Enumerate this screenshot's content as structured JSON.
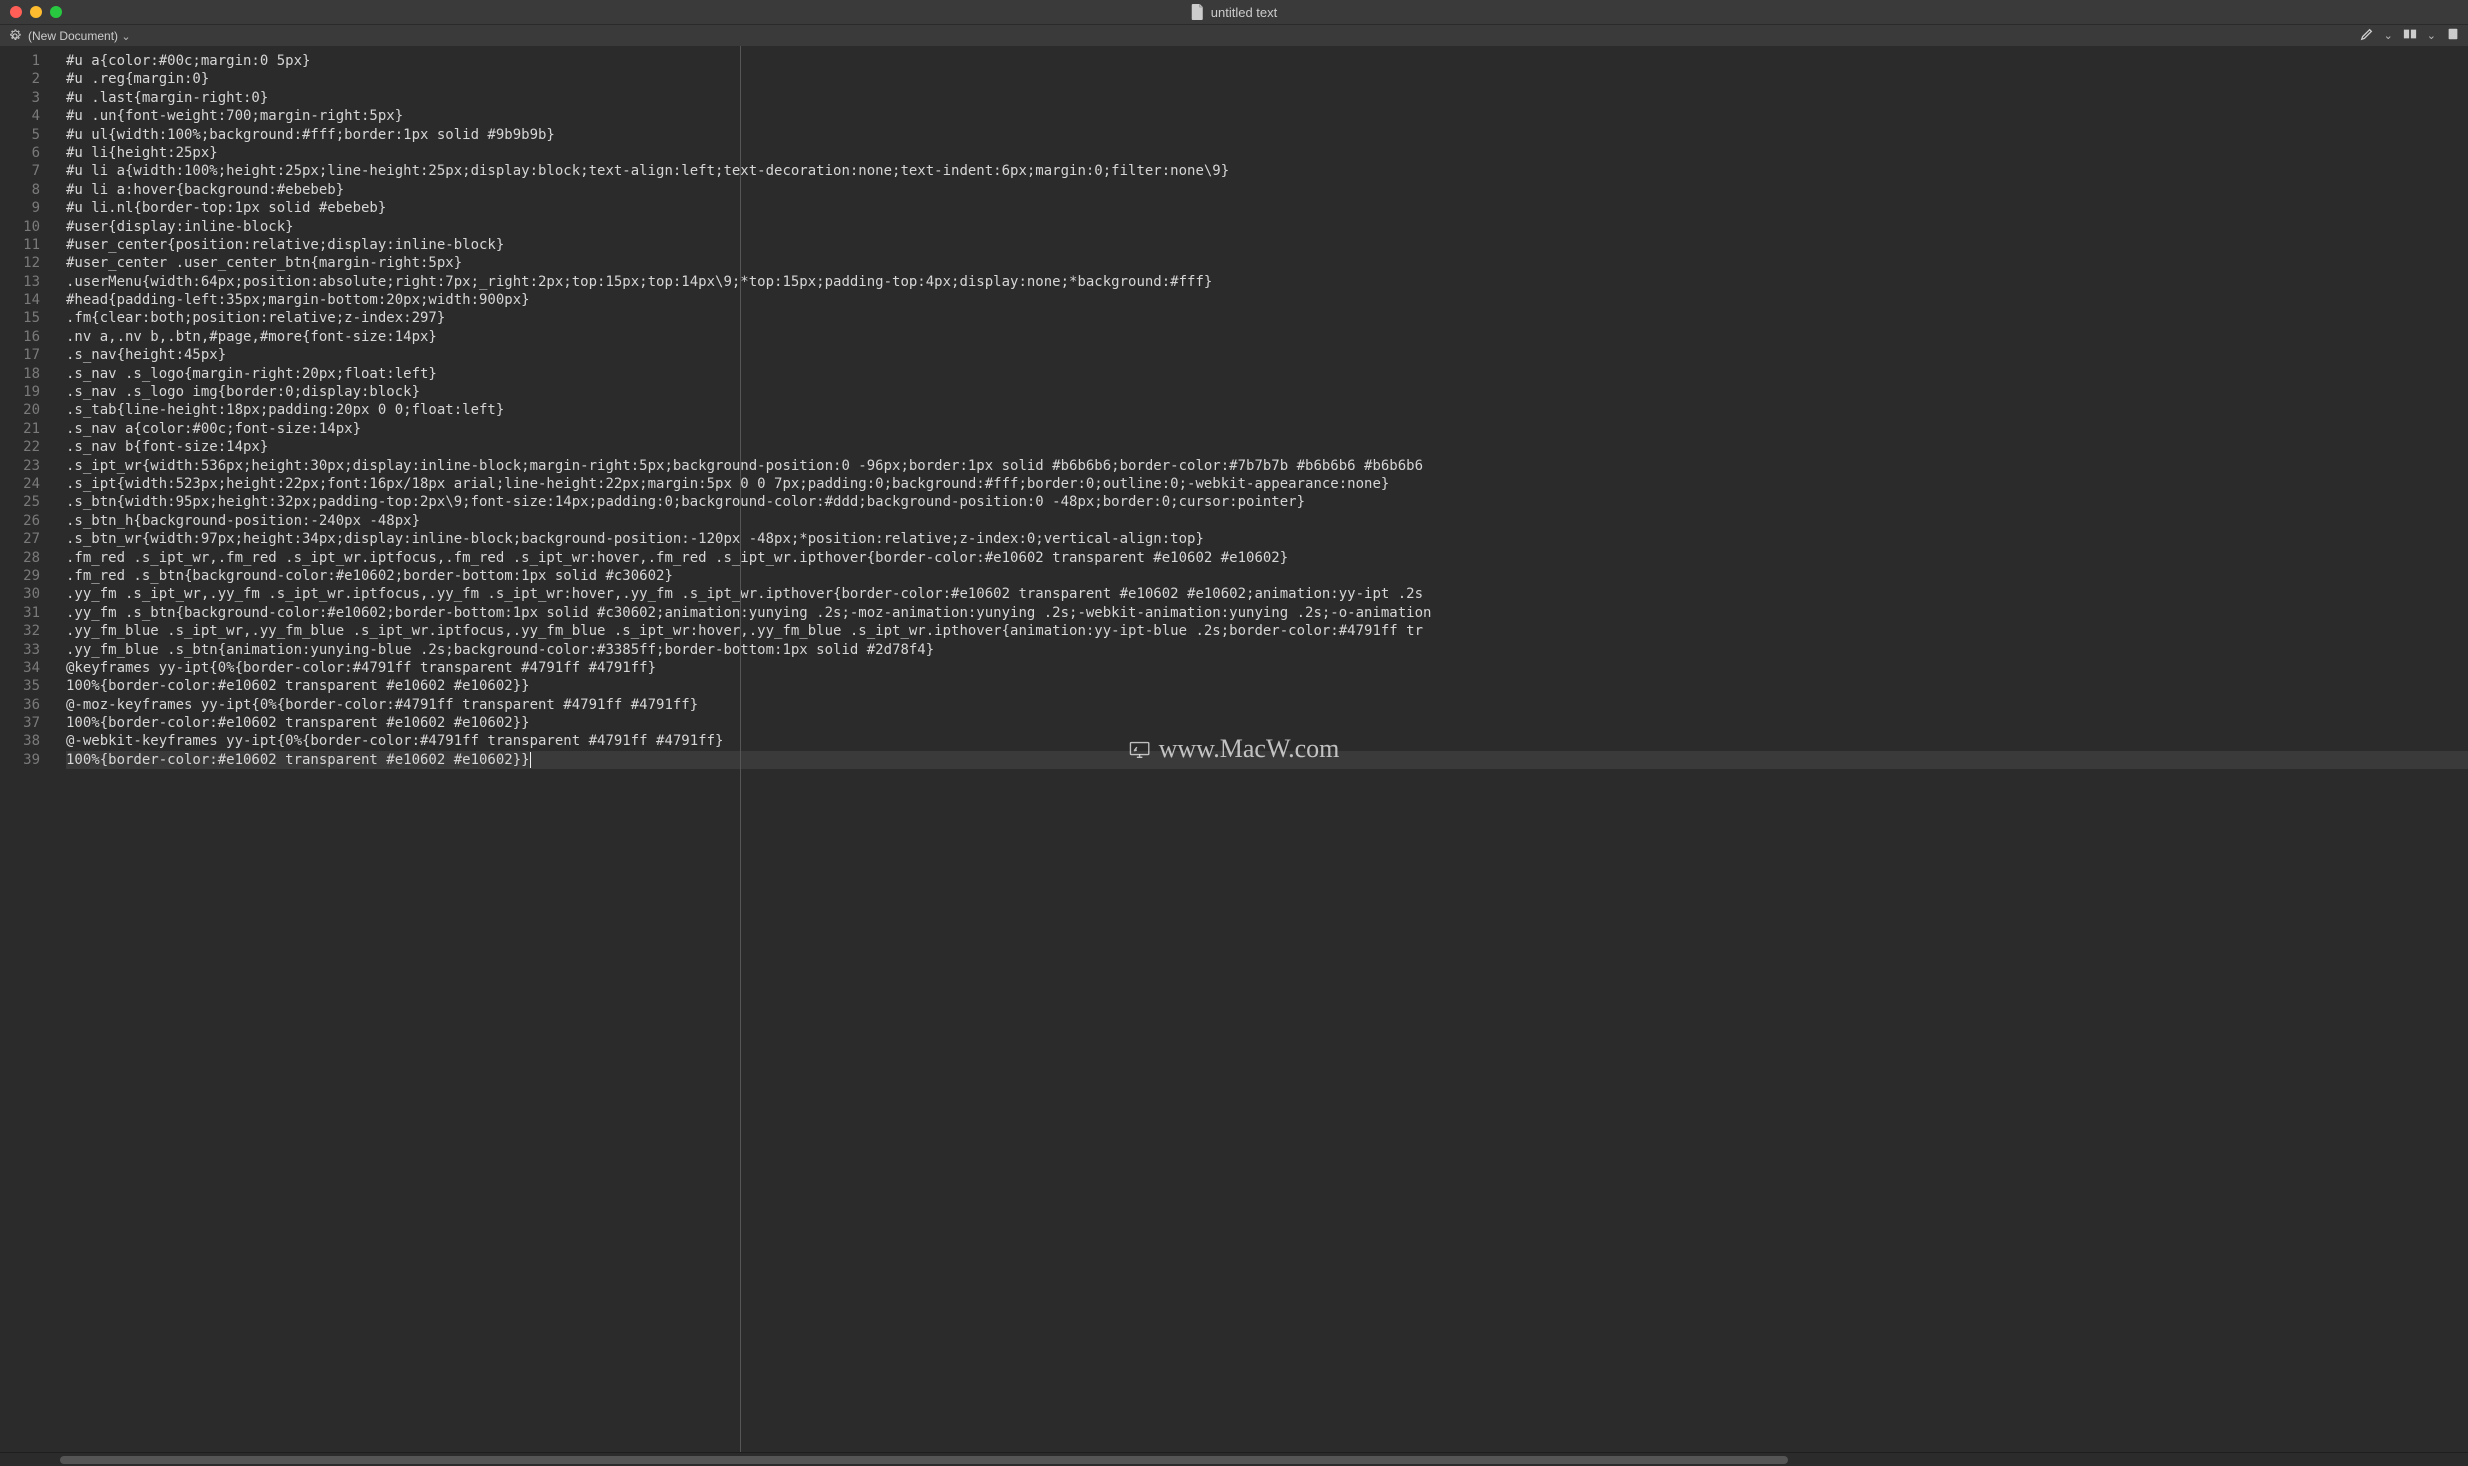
{
  "window": {
    "title": "untitled text"
  },
  "toolbar": {
    "doc_label": "(New Document)"
  },
  "watermark": "www.MacW.com",
  "code": {
    "lines": [
      "#u a{color:#00c;margin:0 5px}",
      "#u .reg{margin:0}",
      "#u .last{margin-right:0}",
      "#u .un{font-weight:700;margin-right:5px}",
      "#u ul{width:100%;background:#fff;border:1px solid #9b9b9b}",
      "#u li{height:25px}",
      "#u li a{width:100%;height:25px;line-height:25px;display:block;text-align:left;text-decoration:none;text-indent:6px;margin:0;filter:none\\9}",
      "#u li a:hover{background:#ebebeb}",
      "#u li.nl{border-top:1px solid #ebebeb}",
      "#user{display:inline-block}",
      "#user_center{position:relative;display:inline-block}",
      "#user_center .user_center_btn{margin-right:5px}",
      ".userMenu{width:64px;position:absolute;right:7px;_right:2px;top:15px;top:14px\\9;*top:15px;padding-top:4px;display:none;*background:#fff}",
      "#head{padding-left:35px;margin-bottom:20px;width:900px}",
      ".fm{clear:both;position:relative;z-index:297}",
      ".nv a,.nv b,.btn,#page,#more{font-size:14px}",
      ".s_nav{height:45px}",
      ".s_nav .s_logo{margin-right:20px;float:left}",
      ".s_nav .s_logo img{border:0;display:block}",
      ".s_tab{line-height:18px;padding:20px 0 0;float:left}",
      ".s_nav a{color:#00c;font-size:14px}",
      ".s_nav b{font-size:14px}",
      ".s_ipt_wr{width:536px;height:30px;display:inline-block;margin-right:5px;background-position:0 -96px;border:1px solid #b6b6b6;border-color:#7b7b7b #b6b6b6 #b6b6b6",
      ".s_ipt{width:523px;height:22px;font:16px/18px arial;line-height:22px;margin:5px 0 0 7px;padding:0;background:#fff;border:0;outline:0;-webkit-appearance:none}",
      ".s_btn{width:95px;height:32px;padding-top:2px\\9;font-size:14px;padding:0;background-color:#ddd;background-position:0 -48px;border:0;cursor:pointer}",
      ".s_btn_h{background-position:-240px -48px}",
      ".s_btn_wr{width:97px;height:34px;display:inline-block;background-position:-120px -48px;*position:relative;z-index:0;vertical-align:top}",
      ".fm_red .s_ipt_wr,.fm_red .s_ipt_wr.iptfocus,.fm_red .s_ipt_wr:hover,.fm_red .s_ipt_wr.ipthover{border-color:#e10602 transparent #e10602 #e10602}",
      ".fm_red .s_btn{background-color:#e10602;border-bottom:1px solid #c30602}",
      ".yy_fm .s_ipt_wr,.yy_fm .s_ipt_wr.iptfocus,.yy_fm .s_ipt_wr:hover,.yy_fm .s_ipt_wr.ipthover{border-color:#e10602 transparent #e10602 #e10602;animation:yy-ipt .2s",
      ".yy_fm .s_btn{background-color:#e10602;border-bottom:1px solid #c30602;animation:yunying .2s;-moz-animation:yunying .2s;-webkit-animation:yunying .2s;-o-animation",
      ".yy_fm_blue .s_ipt_wr,.yy_fm_blue .s_ipt_wr.iptfocus,.yy_fm_blue .s_ipt_wr:hover,.yy_fm_blue .s_ipt_wr.ipthover{animation:yy-ipt-blue .2s;border-color:#4791ff tr",
      ".yy_fm_blue .s_btn{animation:yunying-blue .2s;background-color:#3385ff;border-bottom:1px solid #2d78f4}",
      "@keyframes yy-ipt{0%{border-color:#4791ff transparent #4791ff #4791ff}",
      "100%{border-color:#e10602 transparent #e10602 #e10602}}",
      "@-moz-keyframes yy-ipt{0%{border-color:#4791ff transparent #4791ff #4791ff}",
      "100%{border-color:#e10602 transparent #e10602 #e10602}}",
      "@-webkit-keyframes yy-ipt{0%{border-color:#4791ff transparent #4791ff #4791ff}",
      "100%{border-color:#e10602 transparent #e10602 #e10602}}"
    ],
    "current_line_index": 38
  }
}
